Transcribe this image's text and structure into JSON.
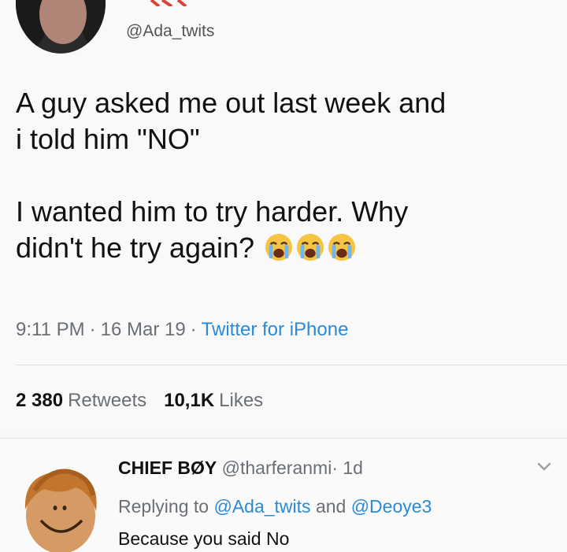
{
  "tweet": {
    "handle": "@Ada_twits",
    "text_line1": "A guy asked me out last week and",
    "text_line2": "i told him \"NO\"",
    "text_line3": "I wanted him to try harder. Why",
    "text_line4": "didn't he try again?",
    "emoji_icons": [
      "loudly-crying-face-icon",
      "loudly-crying-face-icon",
      "loudly-crying-face-icon"
    ],
    "time": "9:11 PM",
    "date": "16 Mar 19",
    "separator": "·",
    "source": "Twitter for iPhone",
    "retweets_count": "2 380",
    "retweets_label": "Retweets",
    "likes_count": "10,1K",
    "likes_label": "Likes"
  },
  "reply": {
    "name": "CHIEF BØY",
    "handle": "@tharferanmi",
    "separator": "·",
    "age": "1d",
    "replying_prefix": "Replying to",
    "mention_1": "@Ada_twits",
    "conjunction": "and",
    "mention_2": "@Deoye3",
    "text": "Because you said No",
    "menu_icon": "chevron-down-icon"
  },
  "colors": {
    "link": "#2b8ad6",
    "muted": "#6a6f75",
    "text": "#111111",
    "background": "#f9f9f9"
  }
}
